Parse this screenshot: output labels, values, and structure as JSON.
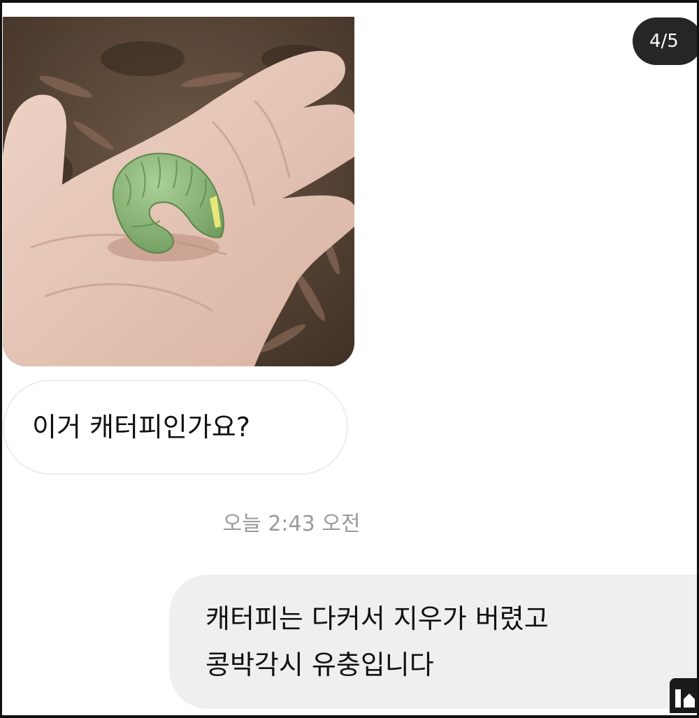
{
  "conversation": {
    "photo": {
      "icon": "photo-message-caterpillar-on-hand"
    },
    "page_indicator": "4/5",
    "incoming_message": "이거 캐터피인가요?",
    "timestamp": "오늘 2:43 오전",
    "outgoing_message": {
      "line1": "캐터피는 다커서 지우가 버렸고",
      "line2": "콩박각시 유충입니다"
    },
    "corner_icon": "gallery-icon"
  },
  "colors": {
    "incoming_bubble": "#ffffff",
    "outgoing_bubble": "#efefef",
    "indicator_bg": "#262626",
    "timestamp_text": "#9a9a9a"
  }
}
